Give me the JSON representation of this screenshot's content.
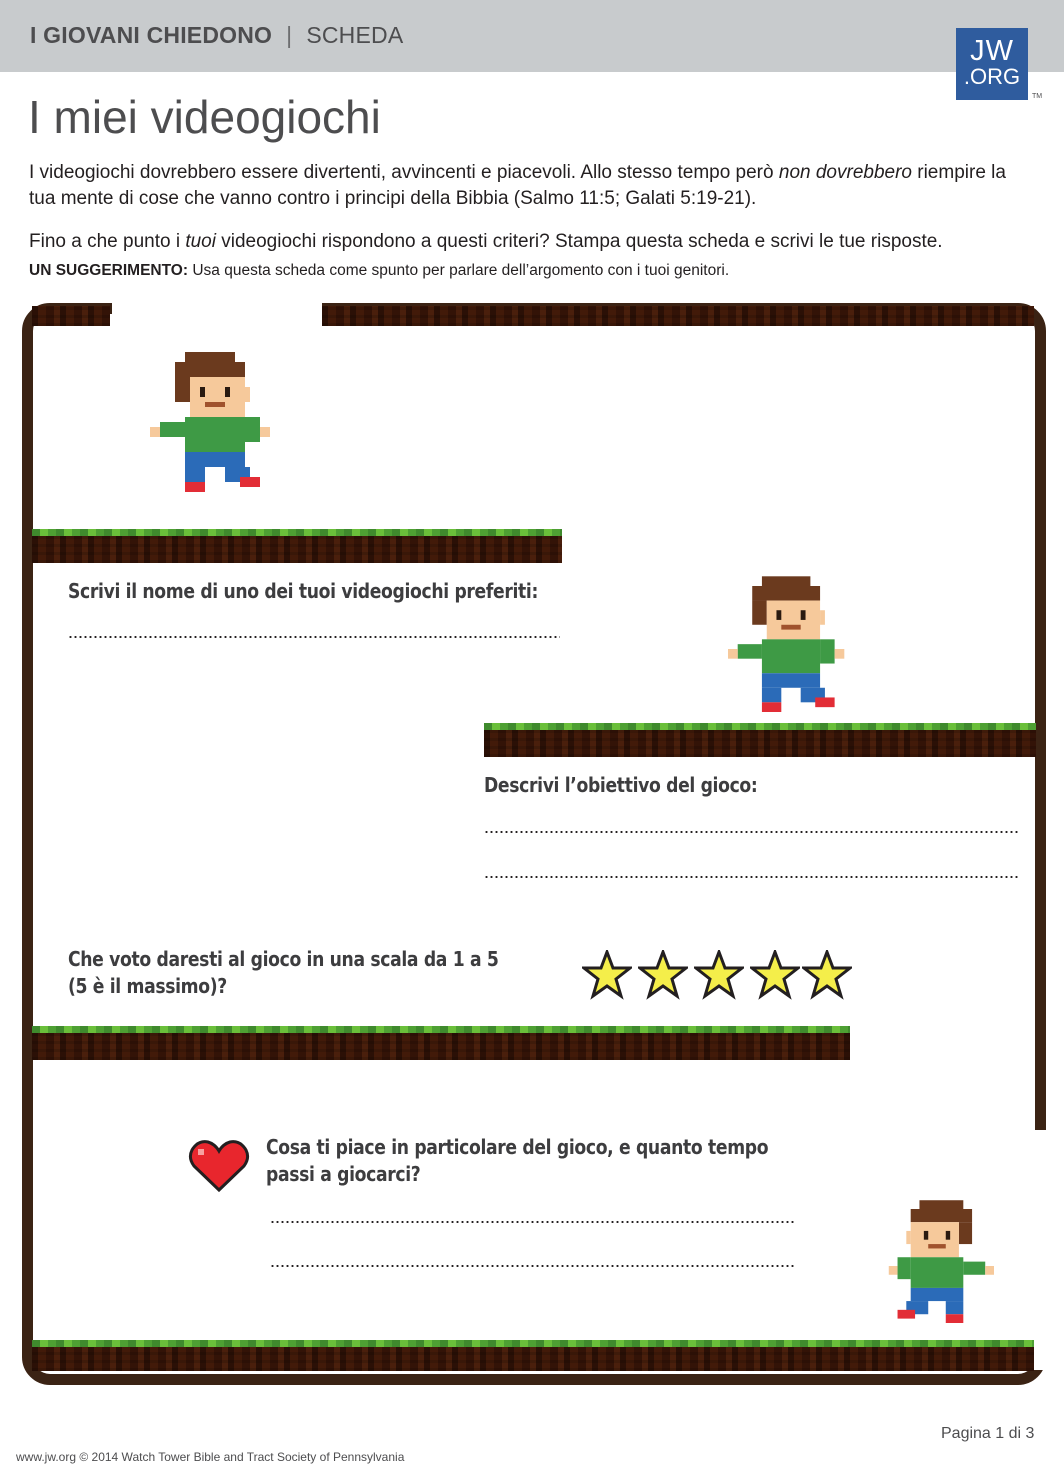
{
  "header": {
    "series": "I GIOVANI CHIEDONO",
    "separator": "|",
    "type": "SCHEDA",
    "logo_line1": "JW",
    "logo_line2": ".ORG",
    "trademark": "TM"
  },
  "title": "I miei videogiochi",
  "intro": {
    "part1": "I videogiochi dovrebbero essere divertenti, avvincenti e piacevoli. Allo stesso tempo però ",
    "emphasis": "non dovrebbero",
    "part2": " riempire la tua mente di cose che vanno contro i principi della Bibbia (Salmo 11:5; Galati 5:19-21)."
  },
  "question": {
    "part1": "Fino a che punto i ",
    "emphasis": "tuoi",
    "part2": " videogiochi rispondono a questi criteri? Stampa questa scheda e scrivi le tue risposte."
  },
  "tip": {
    "label": "UN SUGGERIMENTO:",
    "text": " Usa questa scheda come spunto per parlare dell’argomento con i tuoi genitori."
  },
  "worksheet": {
    "q1": "Scrivi il nome di uno dei tuoi videogiochi preferiti:",
    "q2": "Descrivi l’obiettivo del gioco:",
    "q3_line1": "Che voto daresti al gioco in una scala da 1 a 5",
    "q3_line2": "(5 è il massimo)?",
    "q4_line1": "Cosa ti piace in particolare del gioco, e quanto tempo",
    "q4_line2": "passi a giocarci?",
    "rating_stars": 5
  },
  "colors": {
    "header_bar": "#c8cbcd",
    "logo": "#2f5c9e",
    "frame": "#3b2314",
    "grass": "#4ea033",
    "star_fill": "#f4ee4a",
    "heart_fill": "#e8262d"
  },
  "icons": [
    "character-sprite",
    "star-icon",
    "heart-icon",
    "jw-logo"
  ],
  "footer": {
    "page": "Pagina 1 di 3",
    "copyright": "www.jw.org © 2014 Watch Tower Bible and Tract Society of Pennsylvania"
  }
}
